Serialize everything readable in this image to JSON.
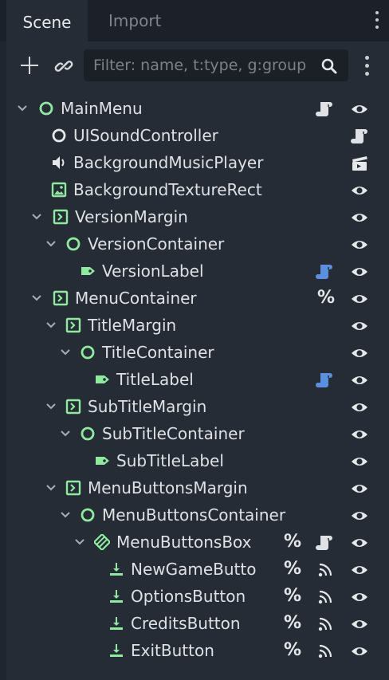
{
  "tabs": {
    "scene": "Scene",
    "import": "Import"
  },
  "search": {
    "placeholder": "Filter: name, t:type, g:group"
  },
  "colors": {
    "accent_green": "#8eeb9e",
    "script_blue": "#5b8fe0",
    "panel_bg": "#262c35"
  },
  "tree": [
    {
      "label": "MainMenu",
      "icon": "node-circle",
      "arrow": "down",
      "script": "plain",
      "visible": true
    },
    {
      "label": "UISoundController",
      "icon": "node-circle-white",
      "script": "plain",
      "visible": false
    },
    {
      "label": "BackgroundMusicPlayer",
      "icon": "speaker-icon",
      "clapper": true
    },
    {
      "label": "BackgroundTextureRect",
      "icon": "texture-rect-icon",
      "visible": true
    },
    {
      "label": "VersionMargin",
      "icon": "margin-container-icon",
      "arrow": "down",
      "visible": true
    },
    {
      "label": "VersionContainer",
      "icon": "node-circle",
      "arrow": "down",
      "visible": true
    },
    {
      "label": "VersionLabel",
      "icon": "label-icon",
      "script": "blue",
      "visible": true
    },
    {
      "label": "MenuContainer",
      "icon": "margin-container-icon",
      "arrow": "down",
      "pct": "%",
      "visible": true
    },
    {
      "label": "TitleMargin",
      "icon": "margin-container-icon",
      "arrow": "down",
      "visible": true
    },
    {
      "label": "TitleContainer",
      "icon": "node-circle",
      "arrow": "down",
      "visible": true
    },
    {
      "label": "TitleLabel",
      "icon": "label-icon",
      "script": "blue",
      "visible": true
    },
    {
      "label": "SubTitleMargin",
      "icon": "margin-container-icon",
      "arrow": "down",
      "visible": true
    },
    {
      "label": "SubTitleContainer",
      "icon": "node-circle",
      "arrow": "down",
      "visible": true
    },
    {
      "label": "SubTitleLabel",
      "icon": "label-icon",
      "visible": true
    },
    {
      "label": "MenuButtonsMargin",
      "icon": "margin-container-icon",
      "arrow": "down",
      "visible": true
    },
    {
      "label": "MenuButtonsContainer",
      "icon": "node-circle",
      "arrow": "down",
      "visible": true
    },
    {
      "label": "MenuButtonsBox",
      "icon": "vbox-icon",
      "arrow": "down",
      "pct": "%",
      "script": "plain",
      "visible": true
    },
    {
      "label": "NewGameButto",
      "icon": "button-icon",
      "pct": "%",
      "signal": true,
      "visible": true
    },
    {
      "label": "OptionsButton",
      "icon": "button-icon",
      "pct": "%",
      "signal": true,
      "visible": true
    },
    {
      "label": "CreditsButton",
      "icon": "button-icon",
      "pct": "%",
      "signal": true,
      "visible": true
    },
    {
      "label": "ExitButton",
      "icon": "button-icon",
      "pct": "%",
      "signal": true,
      "visible": true
    }
  ]
}
